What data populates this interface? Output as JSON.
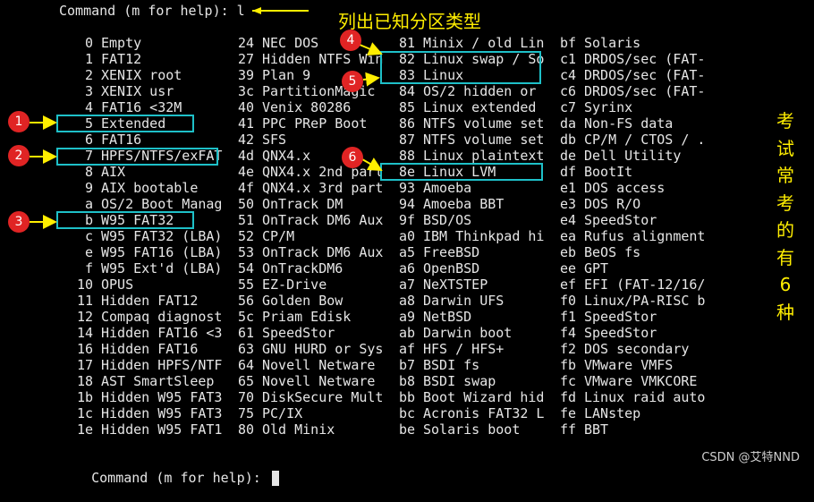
{
  "terminal": {
    "prompt_top": "Command (m for help): l",
    "prompt_bottom": "Command (m for help): ",
    "columns": [
      [
        [
          "0",
          "Empty"
        ],
        [
          "1",
          "FAT12"
        ],
        [
          "2",
          "XENIX root"
        ],
        [
          "3",
          "XENIX usr"
        ],
        [
          "4",
          "FAT16 <32M"
        ],
        [
          "5",
          "Extended"
        ],
        [
          "6",
          "FAT16"
        ],
        [
          "7",
          "HPFS/NTFS/exFAT"
        ],
        [
          "8",
          "AIX"
        ],
        [
          "9",
          "AIX bootable"
        ],
        [
          "a",
          "OS/2 Boot Manag"
        ],
        [
          "b",
          "W95 FAT32"
        ],
        [
          "c",
          "W95 FAT32 (LBA)"
        ],
        [
          "e",
          "W95 FAT16 (LBA)"
        ],
        [
          "f",
          "W95 Ext'd (LBA)"
        ],
        [
          "10",
          "OPUS"
        ],
        [
          "11",
          "Hidden FAT12"
        ],
        [
          "12",
          "Compaq diagnost"
        ],
        [
          "14",
          "Hidden FAT16 <3"
        ],
        [
          "16",
          "Hidden FAT16"
        ],
        [
          "17",
          "Hidden HPFS/NTF"
        ],
        [
          "18",
          "AST SmartSleep"
        ],
        [
          "1b",
          "Hidden W95 FAT3"
        ],
        [
          "1c",
          "Hidden W95 FAT3"
        ],
        [
          "1e",
          "Hidden W95 FAT1"
        ]
      ],
      [
        [
          "24",
          "NEC DOS"
        ],
        [
          "27",
          "Hidden NTFS Win"
        ],
        [
          "39",
          "Plan 9"
        ],
        [
          "3c",
          "PartitionMagic"
        ],
        [
          "40",
          "Venix 80286"
        ],
        [
          "41",
          "PPC PReP Boot"
        ],
        [
          "42",
          "SFS"
        ],
        [
          "4d",
          "QNX4.x"
        ],
        [
          "4e",
          "QNX4.x 2nd part"
        ],
        [
          "4f",
          "QNX4.x 3rd part"
        ],
        [
          "50",
          "OnTrack DM"
        ],
        [
          "51",
          "OnTrack DM6 Aux"
        ],
        [
          "52",
          "CP/M"
        ],
        [
          "53",
          "OnTrack DM6 Aux"
        ],
        [
          "54",
          "OnTrackDM6"
        ],
        [
          "55",
          "EZ-Drive"
        ],
        [
          "56",
          "Golden Bow"
        ],
        [
          "5c",
          "Priam Edisk"
        ],
        [
          "61",
          "SpeedStor"
        ],
        [
          "63",
          "GNU HURD or Sys"
        ],
        [
          "64",
          "Novell Netware"
        ],
        [
          "65",
          "Novell Netware"
        ],
        [
          "70",
          "DiskSecure Mult"
        ],
        [
          "75",
          "PC/IX"
        ],
        [
          "80",
          "Old Minix"
        ]
      ],
      [
        [
          "81",
          "Minix / old Lin"
        ],
        [
          "82",
          "Linux swap / So"
        ],
        [
          "83",
          "Linux"
        ],
        [
          "84",
          "OS/2 hidden or"
        ],
        [
          "85",
          "Linux extended"
        ],
        [
          "86",
          "NTFS volume set"
        ],
        [
          "87",
          "NTFS volume set"
        ],
        [
          "88",
          "Linux plaintext"
        ],
        [
          "8e",
          "Linux LVM"
        ],
        [
          "93",
          "Amoeba"
        ],
        [
          "94",
          "Amoeba BBT"
        ],
        [
          "9f",
          "BSD/OS"
        ],
        [
          "a0",
          "IBM Thinkpad hi"
        ],
        [
          "a5",
          "FreeBSD"
        ],
        [
          "a6",
          "OpenBSD"
        ],
        [
          "a7",
          "NeXTSTEP"
        ],
        [
          "a8",
          "Darwin UFS"
        ],
        [
          "a9",
          "NetBSD"
        ],
        [
          "ab",
          "Darwin boot"
        ],
        [
          "af",
          "HFS / HFS+"
        ],
        [
          "b7",
          "BSDI fs"
        ],
        [
          "b8",
          "BSDI swap"
        ],
        [
          "bb",
          "Boot Wizard hid"
        ],
        [
          "bc",
          "Acronis FAT32 L"
        ],
        [
          "be",
          "Solaris boot"
        ]
      ],
      [
        [
          "bf",
          "Solaris"
        ],
        [
          "c1",
          "DRDOS/sec (FAT-"
        ],
        [
          "c4",
          "DRDOS/sec (FAT-"
        ],
        [
          "c6",
          "DRDOS/sec (FAT-"
        ],
        [
          "c7",
          "Syrinx"
        ],
        [
          "da",
          "Non-FS data"
        ],
        [
          "db",
          "CP/M / CTOS / ."
        ],
        [
          "de",
          "Dell Utility"
        ],
        [
          "df",
          "BootIt"
        ],
        [
          "e1",
          "DOS access"
        ],
        [
          "e3",
          "DOS R/O"
        ],
        [
          "e4",
          "SpeedStor"
        ],
        [
          "ea",
          "Rufus alignment"
        ],
        [
          "eb",
          "BeOS fs"
        ],
        [
          "ee",
          "GPT"
        ],
        [
          "ef",
          "EFI (FAT-12/16/"
        ],
        [
          "f0",
          "Linux/PA-RISC b"
        ],
        [
          "f1",
          "SpeedStor"
        ],
        [
          "f4",
          "SpeedStor"
        ],
        [
          "f2",
          "DOS secondary"
        ],
        [
          "fb",
          "VMware VMFS"
        ],
        [
          "fc",
          "VMware VMKCORE"
        ],
        [
          "fd",
          "Linux raid auto"
        ],
        [
          "fe",
          "LANstep"
        ],
        [
          "ff",
          "BBT"
        ]
      ]
    ]
  },
  "annotations": {
    "top_note": "列出已知分区类型",
    "side_note": [
      "考",
      "试",
      "常",
      "考",
      "的",
      "有",
      "6",
      "种"
    ],
    "badges": [
      "1",
      "2",
      "3",
      "4",
      "5",
      "6"
    ],
    "colors": {
      "box": "#1ec0c8",
      "badge": "#e02424",
      "note": "#ffee00"
    }
  },
  "watermark": "CSDN @艾特NND"
}
